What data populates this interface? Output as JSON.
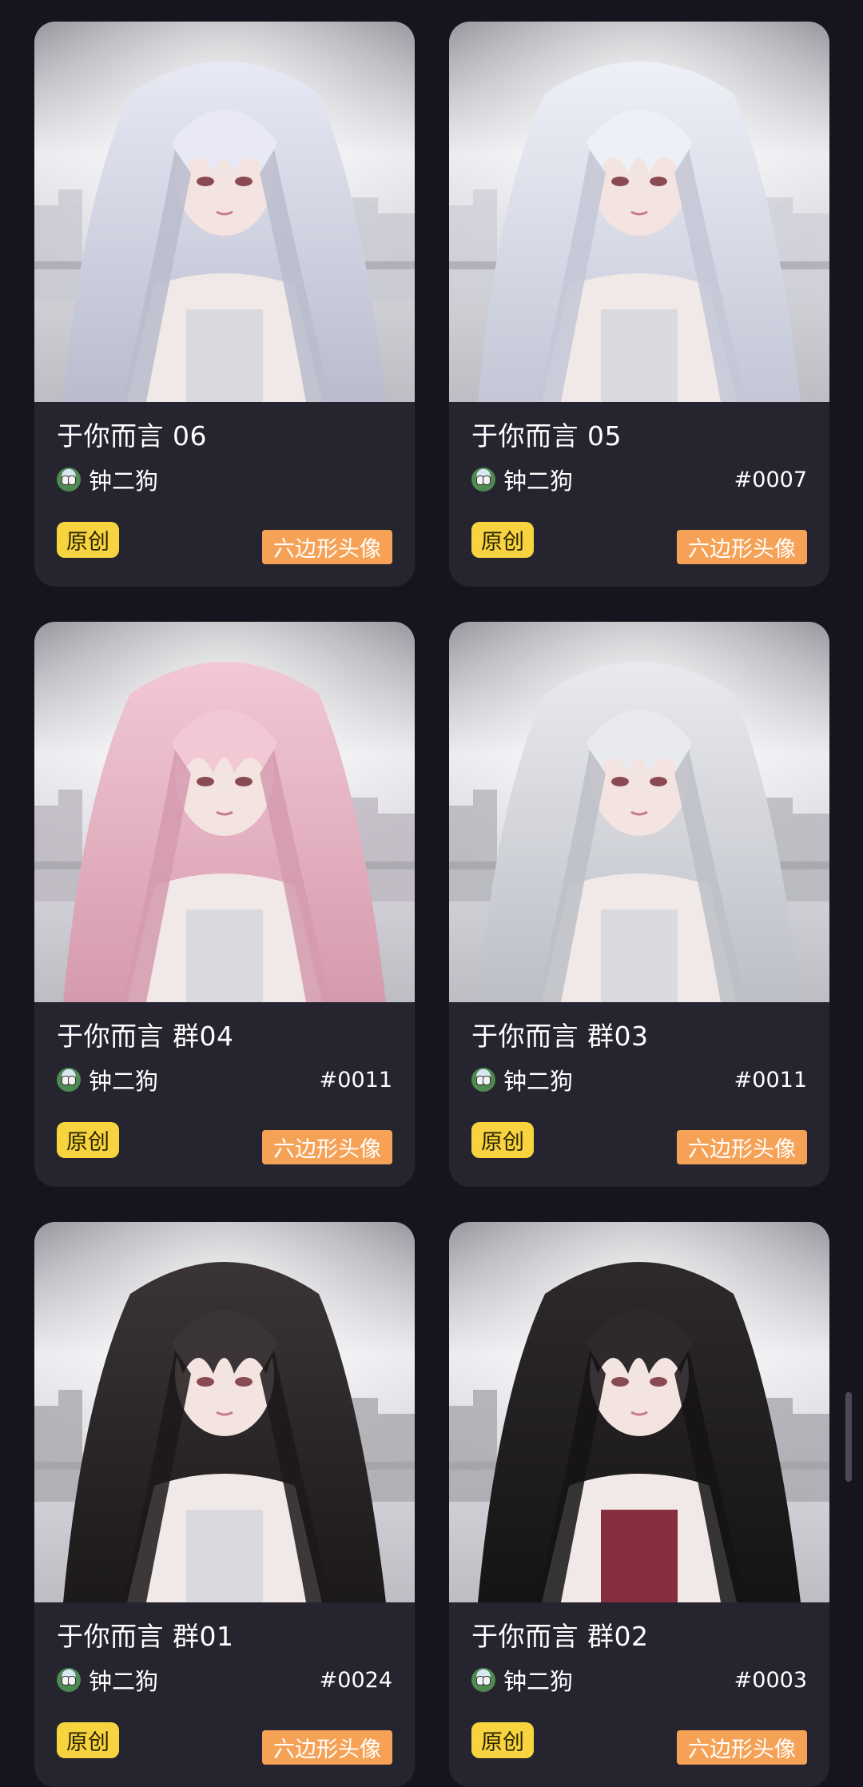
{
  "cards": [
    {
      "title": "于你而言 06",
      "author": "钟二狗",
      "serial": "",
      "tag_original": "原创",
      "tag_type": "六边形头像",
      "hair": "#e8e9f5",
      "hair_dark": "#b9bccd",
      "top_dark": "#c9c9d2"
    },
    {
      "title": "于你而言 05",
      "author": "钟二狗",
      "serial": "#0007",
      "tag_original": "原创",
      "tag_type": "六边形头像",
      "hair": "#eef0f7",
      "hair_dark": "#c3c7d6",
      "top_dark": "#cfd0d8"
    },
    {
      "title": "于你而言 群04",
      "author": "钟二狗",
      "serial": "#0011",
      "tag_original": "原创",
      "tag_type": "六边形头像",
      "hair": "#f2c8d4",
      "hair_dark": "#d59aae",
      "top_dark": "#bdb7c0"
    },
    {
      "title": "于你而言 群03",
      "author": "钟二狗",
      "serial": "#0011",
      "tag_original": "原创",
      "tag_type": "六边形头像",
      "hair": "#e9eaee",
      "hair_dark": "#bcbfc7",
      "top_dark": "#b5b6bc"
    },
    {
      "title": "于你而言 群01",
      "author": "钟二狗",
      "serial": "#0024",
      "tag_original": "原创",
      "tag_type": "六边形头像",
      "hair": "#3a3436",
      "hair_dark": "#1c191a",
      "top_dark": "#a9a9ae"
    },
    {
      "title": "于你而言 群02",
      "author": "钟二狗",
      "serial": "#0003",
      "tag_original": "原创",
      "tag_type": "六边形头像",
      "hair": "#2e2a2c",
      "hair_dark": "#151314",
      "top_dark": "#a8a8ae"
    }
  ],
  "icons": {
    "avatar": "author-avatar-icon"
  }
}
